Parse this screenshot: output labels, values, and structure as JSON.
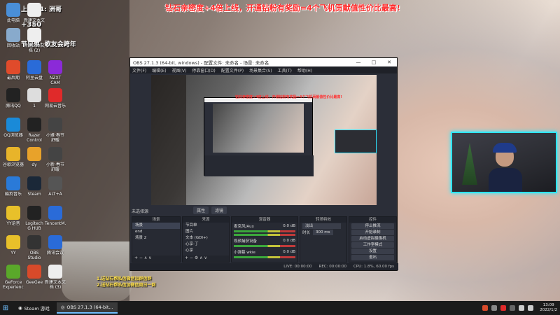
{
  "stream_overlay": {
    "banner": "钻石亲密度+4倍上线，开通钻粉有奖励=4个飞机贡献值性价比最高!",
    "rank_line": "上周榜1: 洲哥",
    "score": "+350",
    "program": "节目单: 歌友会跨年",
    "bottom_lines": [
      "1.送钻石帮私信微信加群信群",
      "2.送钻石帮私信加微信周日一群"
    ]
  },
  "desktop_icons": [
    {
      "label": "此电脑",
      "icon": "computer-icon",
      "color": "#4a8fd8"
    },
    {
      "label": "新建文本文档",
      "icon": "text-document-icon",
      "color": "#eeeeee"
    },
    {
      "label": "回收站",
      "icon": "recycle-bin-icon",
      "color": "#88aacc"
    },
    {
      "label": "新建文本文档 (2)",
      "icon": "text-document-icon",
      "color": "#eeeeee"
    },
    {
      "label": "最后期",
      "icon": "app-icon",
      "color": "#e04b2b"
    },
    {
      "label": "阿里云盘",
      "icon": "cloud-drive-icon",
      "color": "#2a6bd8"
    },
    {
      "label": "NZXT CAM",
      "icon": "nzxt-cam-icon",
      "color": "#8b2ad8"
    },
    {
      "label": "腾讯QQ",
      "icon": "qq-icon",
      "color": "#222222"
    },
    {
      "label": "1",
      "icon": "app-icon",
      "color": "#dddddd"
    },
    {
      "label": "网易云音乐",
      "icon": "netease-music-icon",
      "color": "#e02a2a"
    },
    {
      "label": "QQ浏览器",
      "icon": "qq-browser-icon",
      "color": "#1a8ad8"
    },
    {
      "label": "Razer Control",
      "icon": "razer-icon",
      "color": "#222222"
    },
    {
      "label": "小雅·春节舒暖",
      "icon": "app-icon",
      "color": "#444444"
    },
    {
      "label": "谷歌浏览器",
      "icon": "chrome-icon",
      "color": "#e8b42a"
    },
    {
      "label": "dy",
      "icon": "douyin-icon",
      "color": "#e8a22a"
    },
    {
      "label": "小新·春节舒暖",
      "icon": "app-icon",
      "color": "#444444"
    },
    {
      "label": "酷狗音乐",
      "icon": "kugou-icon",
      "color": "#2a7ad8"
    },
    {
      "label": "Steam",
      "icon": "steam-icon",
      "color": "#1b2838"
    },
    {
      "label": "ALT+A",
      "icon": "app-icon",
      "color": "#555555"
    },
    {
      "label": "YY语音",
      "icon": "yy-icon",
      "color": "#e8c02a"
    },
    {
      "label": "Logitech G HUB",
      "icon": "logitech-icon",
      "color": "#222222"
    },
    {
      "label": "TencentM...",
      "icon": "tencent-meeting-icon",
      "color": "#2a6bd8"
    },
    {
      "label": "YY",
      "icon": "yy-icon",
      "color": "#e8c02a"
    },
    {
      "label": "OBS Studio",
      "icon": "obs-icon",
      "color": "#333333"
    },
    {
      "label": "腾讯会议",
      "icon": "tencent-meeting-icon",
      "color": "#2a6bd8"
    },
    {
      "label": "GeForce Experience",
      "icon": "geforce-icon",
      "color": "#5aa82a"
    },
    {
      "label": "GeeGee",
      "icon": "app-icon",
      "color": "#d84a2a"
    },
    {
      "label": "新建文本文档 (3)",
      "icon": "text-document-icon",
      "color": "#eeeeee"
    }
  ],
  "obs": {
    "title": "OBS 27.1.3 (64-bit, windows) - 配置文件: 未命名 - 场景: 未命名",
    "window_controls": [
      "—",
      "□",
      "✕"
    ],
    "menu": [
      "文件(F)",
      "编辑(E)",
      "视图(V)",
      "停靠窗口(D)",
      "配置文件(P)",
      "场景集合(S)",
      "工具(T)",
      "帮助(H)"
    ],
    "no_source_label": "未选择源",
    "props_button": "属性",
    "filters_button": "滤镜",
    "scenes": {
      "header": "场景",
      "items": [
        "场景",
        "end",
        "场景 2"
      ]
    },
    "sources": {
      "header": "来源",
      "items": [
        "节目单",
        "图片",
        "文本 (GDI+)",
        "心享-丁",
        "心享"
      ]
    },
    "mixer": {
      "header": "混音器",
      "channels": [
        {
          "name": "麦克风/Aux",
          "db": "0.0 dB"
        },
        {
          "name": "视频捕获设备",
          "db": "0.0 dB"
        },
        {
          "name": "小弹幕 wkie",
          "db": "0.0 dB"
        }
      ]
    },
    "transitions": {
      "header": "转场特效",
      "type": "淡出",
      "duration_label": "时长",
      "duration": "300 ms"
    },
    "controls": {
      "header": "控件",
      "buttons": [
        "停止推流",
        "开始录制",
        "启动虚拟摄像机",
        "工作室模式",
        "设置",
        "退出"
      ]
    },
    "status": {
      "live": "LIVE: 00:00:00",
      "rec": "REC: 00:00:00",
      "cpu": "CPU: 1.8%, 60.00 fps"
    }
  },
  "taskbar": {
    "items": [
      "Steam 游戏",
      "OBS 27.1.3 (64-bit..."
    ],
    "time": "13:09",
    "date": "2022/1/2"
  }
}
